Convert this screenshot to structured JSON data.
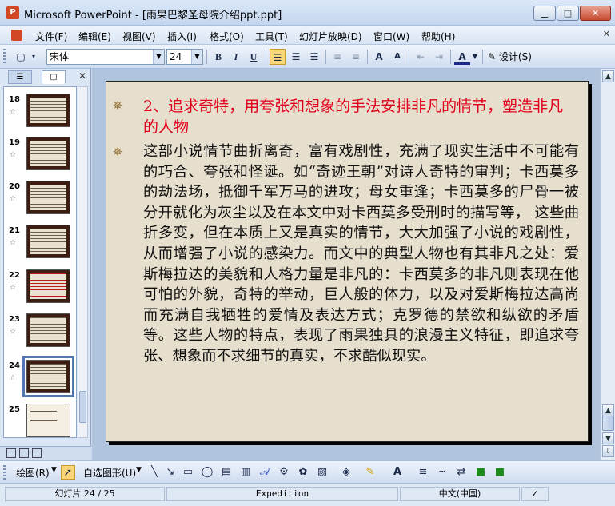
{
  "window": {
    "title": "Microsoft PowerPoint - [雨果巴黎圣母院介绍ppt.ppt]",
    "app_icon": "powerpoint-icon",
    "min_label": "▁",
    "max_label": "□",
    "close_label": "✕"
  },
  "menu": {
    "items": [
      "文件(F)",
      "编辑(E)",
      "视图(V)",
      "插入(I)",
      "格式(O)",
      "工具(T)",
      "幻灯片放映(D)",
      "窗口(W)",
      "帮助(H)"
    ],
    "close_label": "✕"
  },
  "toolbar": {
    "font_name": "宋体",
    "font_size": "24",
    "bold": "B",
    "italic": "I",
    "underline": "U",
    "design_label": "设计(S)"
  },
  "thumbnails": [
    {
      "number": "18",
      "style": "dark"
    },
    {
      "number": "19",
      "style": "dark"
    },
    {
      "number": "20",
      "style": "dark"
    },
    {
      "number": "21",
      "style": "dark"
    },
    {
      "number": "22",
      "style": "dark-red"
    },
    {
      "number": "23",
      "style": "dark"
    },
    {
      "number": "24",
      "style": "dark",
      "selected": true
    },
    {
      "number": "25",
      "style": "plain"
    }
  ],
  "slide": {
    "heading": "2、追求奇特，用夸张和想象的手法安排非凡的情节，塑造非凡的人物",
    "body": "这部小说情节曲折离奇，富有戏剧性，充满了现实生活中不可能有的巧合、夸张和怪诞。如“奇迹王朝”对诗人奇特的审判；卡西莫多的劫法场，抵御千军万马的进攻；母女重逢；卡西莫多的尸骨一被分开就化为灰尘以及在本文中对卡西莫多受刑时的描写等， 这些曲折多变，但在本质上又是真实的情节，大大加强了小说的戏剧性，从而增强了小说的感染力。而文中的典型人物也有其非凡之处：爱斯梅拉达的美貌和人格力量是非凡的：卡西莫多的非凡则表现在他可怕的外貌，奇特的举动，巨人般的体力，以及对爱斯梅拉达高尚而充满自我牺牲的爱情及表达方式；克罗德的禁欲和纵欲的矛盾等。这些人物的特点，表现了雨果独具的浪漫主义特征，即追求夸张、想象而不求细节的真实，不求酷似现实。"
  },
  "drawbar": {
    "draw_label": "绘图(R)",
    "autoshape_label": "自选图形(U)"
  },
  "status": {
    "slide_info": "幻灯片 24 / 25",
    "template": "Expedition",
    "language": "中文(中国)"
  }
}
